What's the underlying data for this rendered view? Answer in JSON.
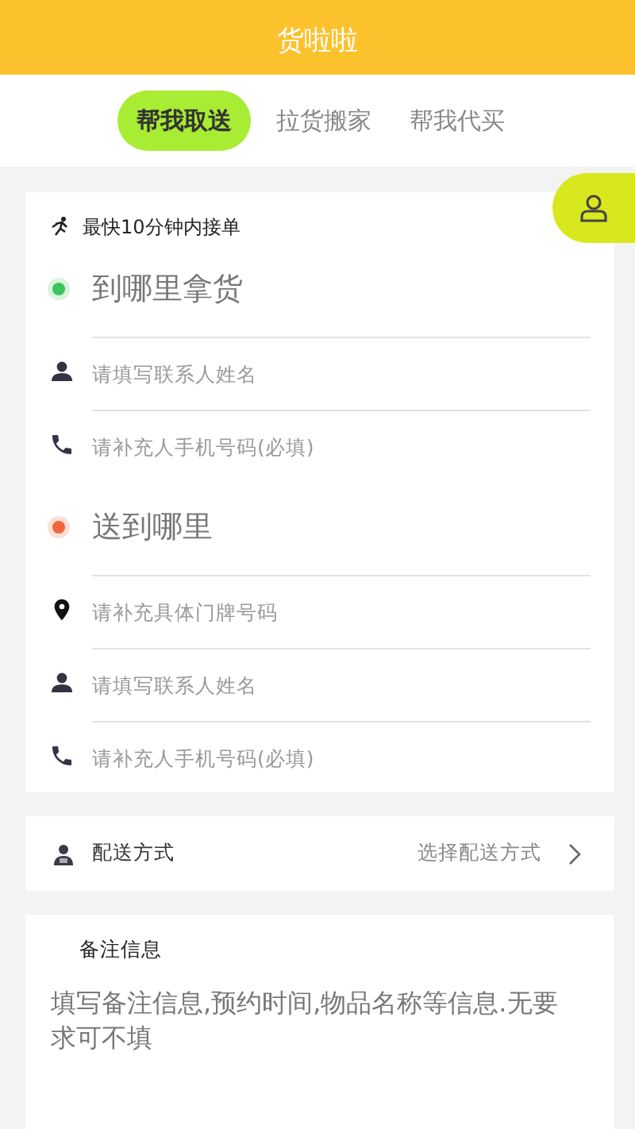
{
  "header": {
    "title": "货啦啦"
  },
  "tabs": [
    {
      "label": "帮我取送",
      "selected": true
    },
    {
      "label": "拉货搬家",
      "selected": false
    },
    {
      "label": "帮我代买",
      "selected": false
    }
  ],
  "order_card": {
    "speed_note": "最快10分钟内接单",
    "sections": [
      {
        "heading": "到哪里拿货",
        "color": "#3cc45c",
        "fields": [
          {
            "kind": "person",
            "placeholder": "请填写联系人姓名"
          },
          {
            "kind": "phone",
            "placeholder": "请补充人手机号码(必填)"
          }
        ]
      },
      {
        "heading": "送到哪里",
        "color": "#f0663a",
        "fields": [
          {
            "kind": "pin",
            "placeholder": "请补充具体门牌号码"
          },
          {
            "kind": "person",
            "placeholder": "请填写联系人姓名"
          },
          {
            "kind": "phone",
            "placeholder": "请补充人手机号码(必填)"
          }
        ]
      }
    ]
  },
  "delivery": {
    "label": "配送方式",
    "value": "选择配送方式"
  },
  "notes": {
    "title": "备注信息",
    "placeholder": "填写备注信息,预约时间,物品名称等信息.无要求可不填"
  }
}
